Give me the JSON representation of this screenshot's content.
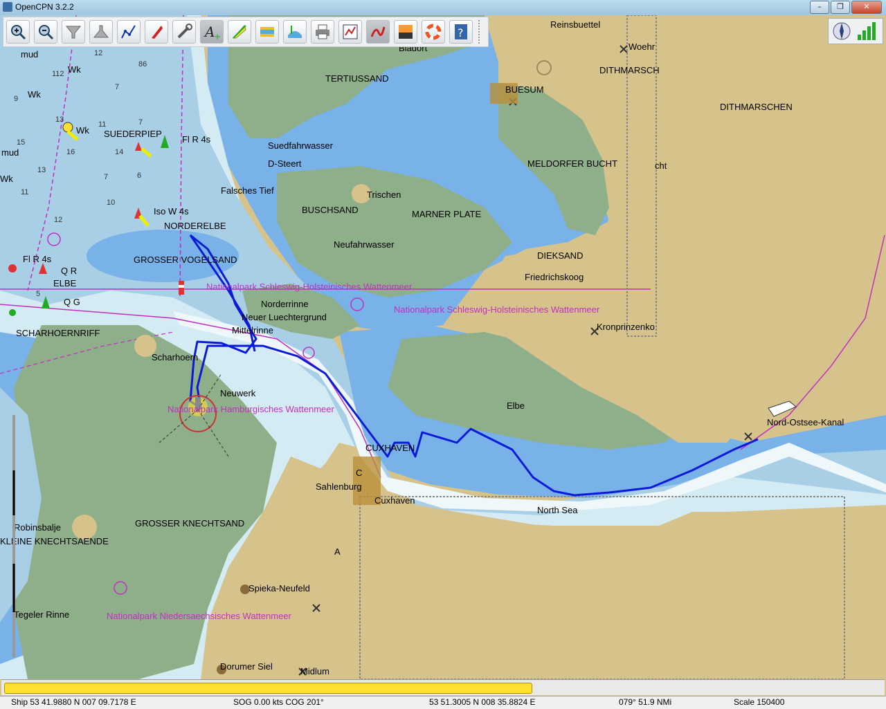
{
  "window": {
    "title": "OpenCPN 3.2.2",
    "min": "–",
    "max": "❐",
    "close": "✕"
  },
  "toolbar": {
    "buttons": [
      {
        "name": "zoom-in-button",
        "icon": "magnifier-plus-icon"
      },
      {
        "name": "zoom-out-button",
        "icon": "magnifier-minus-icon"
      },
      {
        "name": "scale-in-button",
        "icon": "funnel-down-icon"
      },
      {
        "name": "scale-out-button",
        "icon": "funnel-up-icon"
      },
      {
        "name": "route-button",
        "icon": "route-icon"
      },
      {
        "name": "auto-follow-button",
        "icon": "boat-icon"
      },
      {
        "name": "settings-button",
        "icon": "wrench-icon"
      },
      {
        "name": "text-button",
        "icon": "text-icon"
      },
      {
        "name": "current-button",
        "icon": "current-icon"
      },
      {
        "name": "tide-button",
        "icon": "tide-icon"
      },
      {
        "name": "ais-button",
        "icon": "ais-icon"
      },
      {
        "name": "print-button",
        "icon": "printer-icon"
      },
      {
        "name": "route-manager-button",
        "icon": "route-manager-icon"
      },
      {
        "name": "track-button",
        "icon": "track-icon"
      },
      {
        "name": "color-scheme-button",
        "icon": "sunset-icon"
      },
      {
        "name": "mob-button",
        "icon": "lifebuoy-icon"
      },
      {
        "name": "help-button",
        "icon": "help-icon"
      }
    ]
  },
  "chart_labels": {
    "reinsbuettel": "Reinsbuettel",
    "woehr": "Woehr",
    "bladort": "Bladort",
    "tertiussand": "TERTIUSSAND",
    "dithmarsch": "DITHMARSCH",
    "buesum": "BUESUM",
    "dithmarschen": "DITHMARSCHEN",
    "suedfahrwasser": "Suedfahrwasser",
    "d_steert": "D-Steert",
    "meldorfer": "MELDORFER BUCHT",
    "cht": "cht",
    "falsches_tief": "Falsches Tief",
    "trischen": "Trischen",
    "buschsand": "BUSCHSAND",
    "marner_plate": "MARNER PLATE",
    "neufahrwasser": "Neufahrwasser",
    "dieksand": "DIEKSAND",
    "friedrichskoog": "Friedrichskoog",
    "iso_w": "Iso W 4s",
    "norderelbe": "NORDERELBE",
    "grosser_vogelsand": "GROSSER VOGELSAND",
    "np_sh1": "Nationalpark Schleswig-Holsteinisches Wattenmeer",
    "np_sh2": "Nationalpark Schleswig-Holsteinisches Wattenmeer",
    "norderrinne": "Norderrinne",
    "neuer_luechtergrund": "Neuer Luechtergrund",
    "mittelrinne": "Mittelrinne",
    "kronprinzenkoog": "Kronprinzenko",
    "scharhoernriff": "SCHARHOERNRIFF",
    "scharhoern": "Scharhoern",
    "neuwerk": "Neuwerk",
    "np_hh": "Nationalpark Hamburgisches Wattenmeer",
    "elbe": "Elbe",
    "nok": "Nord-Ostsee-Kanal",
    "cuxhaven_upper": "CUXHAVEN",
    "c": "C",
    "sahlenburg": "Sahlenburg",
    "cuxhaven": "Cuxhaven",
    "north_sea": "North Sea",
    "robinsbalje": "Robinsbalje",
    "kleine": "KLEINE KNECHTSAENDE",
    "grosser_knechtsand": "GROSSER KNECHTSAND",
    "a": "A",
    "spieka": "Spieka-Neufeld",
    "np_ns": "Nationalpark Niedersaechsisches Wattenmeer",
    "tegeler": "Tegeler Rinne",
    "dorumer": "Dorumer Siel",
    "midlum": "Midlum",
    "mud1": "mud",
    "mud2": "mud",
    "wk1": "Wk",
    "wk2": "Wk",
    "wk3": "Wk",
    "wk4": "Wk",
    "suederpiep": "SUEDERPIEP",
    "fl_r_4s_a": "Fl R 4s",
    "fl_r_4s_b": "Fl R 4s",
    "q_r": "Q R",
    "elbe_buoy": "ELBE",
    "q_g": "Q G",
    "d_86": "86",
    "d_112": "112",
    "d_122": "12",
    "d_9": "9",
    "d_13": "13",
    "d_113": "11",
    "d_157": "15",
    "d_16": "16",
    "d_14": "14",
    "d_13b": "13",
    "d_79": "7",
    "d_66": "6",
    "d_114": "11",
    "d_109": "10",
    "d_129": "12",
    "d_5": "5",
    "d_77": "7",
    "d_72": "7"
  },
  "colors": {
    "deep_water": "#d4ebf4",
    "medium_water": "#a8cfe6",
    "shallow_water": "#78b2e8",
    "drying": "#8fae8a",
    "land": "#d6c38b",
    "track": "#0a1ad8",
    "magenta": "#c030c0"
  },
  "progress": {
    "fraction": 0.6
  },
  "status": {
    "ship": "Ship 53 41.9880 N   007 09.7178 E",
    "sog": "SOG 0.00 kts   COG 201°",
    "cursor": "53 51.3005 N    008 35.8824 E",
    "bearing": "079°   51.9 NMi",
    "scale": "Scale 150400"
  }
}
